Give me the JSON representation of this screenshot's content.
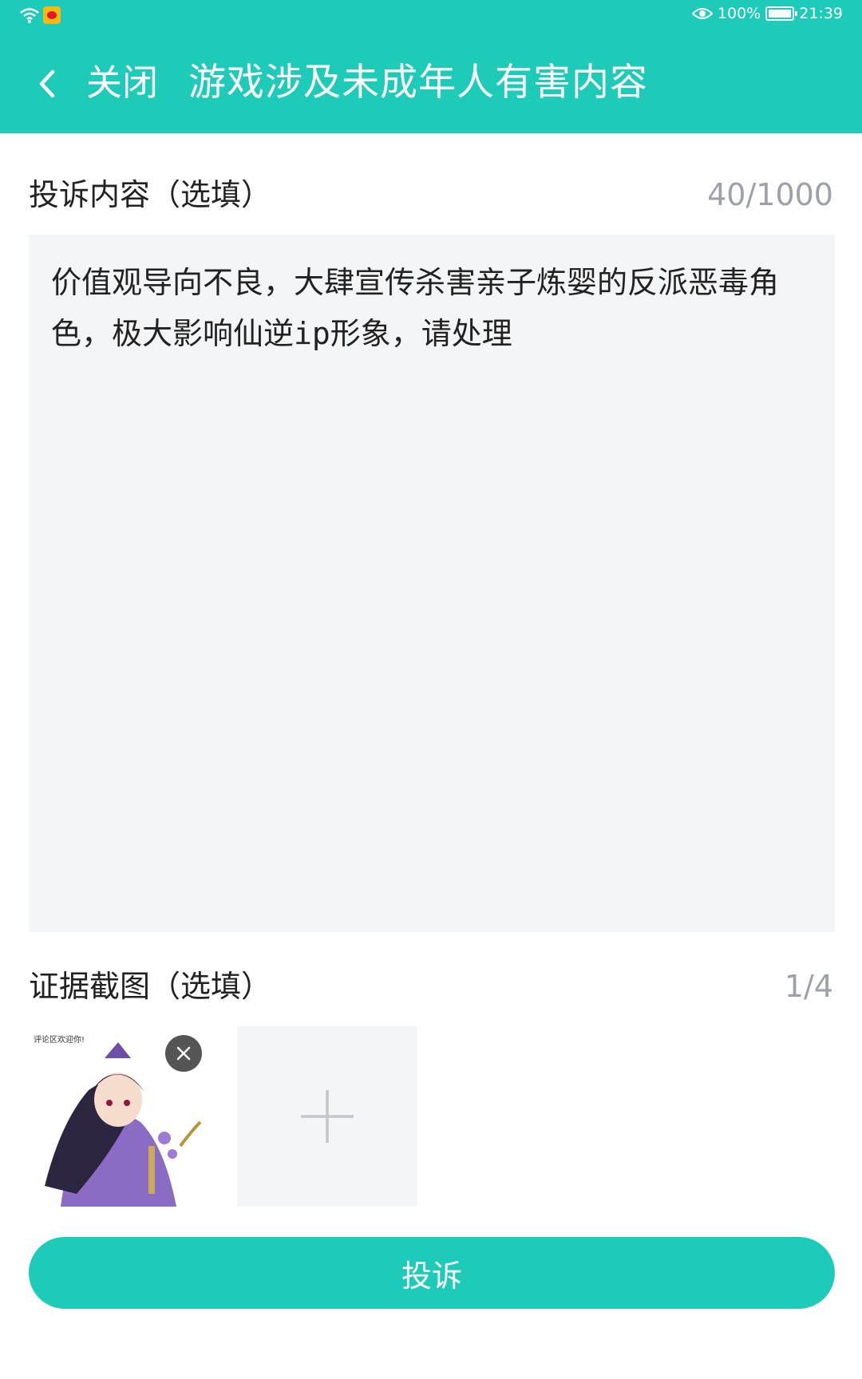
{
  "status_bar": {
    "battery": "100%",
    "time": "21:39"
  },
  "nav": {
    "close": "关闭",
    "title": "游戏涉及未成年人有害内容"
  },
  "complaint": {
    "label": "投诉内容（选填）",
    "counter": "40/1000",
    "text": "价值观导向不良，大肆宣传杀害亲子炼婴的反派恶毒角色，极大影响仙逆ip形象，请处理"
  },
  "evidence": {
    "label": "证据截图（选填）",
    "counter": "1/4",
    "thumbnail_caption": "评论区欢迎你!"
  },
  "submit_label": "投诉",
  "colors": {
    "accent": "#1dcbb8",
    "field_bg": "#f4f5f7"
  }
}
